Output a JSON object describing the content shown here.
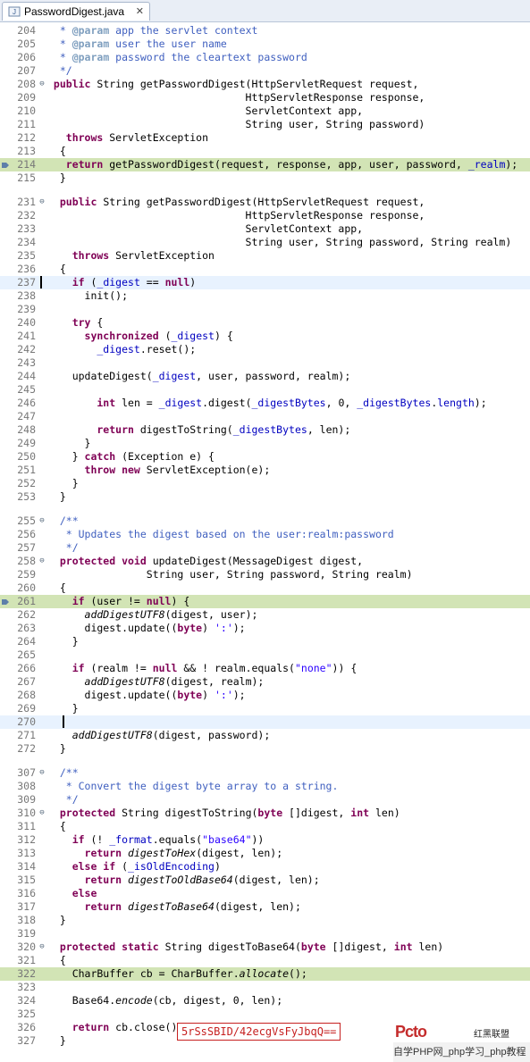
{
  "tab": {
    "label": "PasswordDigest.java",
    "close": "✕"
  },
  "code": [
    {
      "n": "204",
      "fold": "",
      "hl": "",
      "t": [
        [
          "cm",
          "  * "
        ],
        [
          "tag",
          "@param"
        ],
        [
          "cm",
          " app the servlet context"
        ]
      ]
    },
    {
      "n": "205",
      "fold": "",
      "hl": "",
      "t": [
        [
          "cm",
          "  * "
        ],
        [
          "tag",
          "@param"
        ],
        [
          "cm",
          " user the user name"
        ]
      ]
    },
    {
      "n": "206",
      "fold": "",
      "hl": "",
      "t": [
        [
          "cm",
          "  * "
        ],
        [
          "tag",
          "@param"
        ],
        [
          "cm",
          " password the cleartext password"
        ]
      ]
    },
    {
      "n": "207",
      "fold": "",
      "hl": "",
      "t": [
        [
          "cm",
          "  */"
        ]
      ]
    },
    {
      "n": "208",
      "fold": "⊖",
      "hl": "",
      "t": [
        [
          "kw",
          " public "
        ],
        [
          "",
          "String getPasswordDigest(HttpServletRequest request,"
        ]
      ]
    },
    {
      "n": "209",
      "fold": "",
      "hl": "",
      "t": [
        [
          "",
          "                                HttpServletResponse response,"
        ]
      ]
    },
    {
      "n": "210",
      "fold": "",
      "hl": "",
      "t": [
        [
          "",
          "                                ServletContext app,"
        ]
      ]
    },
    {
      "n": "211",
      "fold": "",
      "hl": "",
      "t": [
        [
          "",
          "                                String user, String password)"
        ]
      ]
    },
    {
      "n": "212",
      "fold": "",
      "hl": "",
      "t": [
        [
          "kw",
          "   throws "
        ],
        [
          "",
          "ServletException"
        ]
      ]
    },
    {
      "n": "213",
      "fold": "",
      "hl": "",
      "t": [
        [
          "",
          "  {"
        ]
      ]
    },
    {
      "n": "214",
      "fold": "",
      "hl": "green",
      "t": [
        [
          "kw",
          "   return "
        ],
        [
          "",
          "getPasswordDigest(request, response, app, user, password, "
        ],
        [
          "fld",
          "_realm"
        ],
        [
          "",
          ");"
        ]
      ]
    },
    {
      "n": "215",
      "fold": "",
      "hl": "",
      "t": [
        [
          "",
          "  }"
        ]
      ]
    },
    {
      "n": "",
      "sep": true
    },
    {
      "n": "231",
      "fold": "⊖",
      "hl": "",
      "t": [
        [
          "kw",
          "  public "
        ],
        [
          "",
          "String getPasswordDigest(HttpServletRequest request,"
        ]
      ]
    },
    {
      "n": "232",
      "fold": "",
      "hl": "",
      "t": [
        [
          "",
          "                                HttpServletResponse response,"
        ]
      ]
    },
    {
      "n": "233",
      "fold": "",
      "hl": "",
      "t": [
        [
          "",
          "                                ServletContext app,"
        ]
      ]
    },
    {
      "n": "234",
      "fold": "",
      "hl": "",
      "t": [
        [
          "",
          "                                String user, String password, String realm)"
        ]
      ]
    },
    {
      "n": "235",
      "fold": "",
      "hl": "",
      "t": [
        [
          "kw",
          "    throws "
        ],
        [
          "",
          "ServletException"
        ]
      ]
    },
    {
      "n": "236",
      "fold": "",
      "hl": "",
      "t": [
        [
          "",
          "  {"
        ]
      ]
    },
    {
      "n": "237",
      "fold": "",
      "hl": "blue",
      "t": [
        [
          "kw",
          "    if "
        ],
        [
          "",
          "("
        ],
        [
          "fld",
          "_digest"
        ],
        [
          "",
          " == "
        ],
        [
          "kw",
          "null"
        ],
        [
          "",
          ")"
        ]
      ]
    },
    {
      "n": "238",
      "fold": "",
      "hl": "",
      "t": [
        [
          "",
          "      init();"
        ]
      ]
    },
    {
      "n": "239",
      "fold": "",
      "hl": "",
      "t": [
        [
          "",
          ""
        ]
      ]
    },
    {
      "n": "240",
      "fold": "",
      "hl": "",
      "t": [
        [
          "kw",
          "    try "
        ],
        [
          "",
          "{"
        ]
      ]
    },
    {
      "n": "241",
      "fold": "",
      "hl": "",
      "t": [
        [
          "kw",
          "      synchronized "
        ],
        [
          "",
          "("
        ],
        [
          "fld",
          "_digest"
        ],
        [
          "",
          ") {"
        ]
      ]
    },
    {
      "n": "242",
      "fold": "",
      "hl": "",
      "t": [
        [
          "fld",
          "        _digest"
        ],
        [
          "",
          ".reset();"
        ]
      ]
    },
    {
      "n": "243",
      "fold": "",
      "hl": "",
      "t": [
        [
          "",
          ""
        ]
      ]
    },
    {
      "n": "244",
      "fold": "",
      "hl": "",
      "t": [
        [
          "",
          "    updateDigest("
        ],
        [
          "fld",
          "_digest"
        ],
        [
          "",
          ", user, password, realm);"
        ]
      ]
    },
    {
      "n": "245",
      "fold": "",
      "hl": "",
      "t": [
        [
          "",
          ""
        ]
      ]
    },
    {
      "n": "246",
      "fold": "",
      "hl": "",
      "t": [
        [
          "kw",
          "        int "
        ],
        [
          "",
          "len = "
        ],
        [
          "fld",
          "_digest"
        ],
        [
          "",
          ".digest("
        ],
        [
          "fld",
          "_digestBytes"
        ],
        [
          "",
          ", 0, "
        ],
        [
          "fld",
          "_digestBytes"
        ],
        [
          "",
          "."
        ],
        [
          "fld",
          "length"
        ],
        [
          "",
          ");"
        ]
      ]
    },
    {
      "n": "247",
      "fold": "",
      "hl": "",
      "t": [
        [
          "",
          ""
        ]
      ]
    },
    {
      "n": "248",
      "fold": "",
      "hl": "",
      "t": [
        [
          "kw",
          "        return "
        ],
        [
          "",
          "digestToString("
        ],
        [
          "fld",
          "_digestBytes"
        ],
        [
          "",
          ", len);"
        ]
      ]
    },
    {
      "n": "249",
      "fold": "",
      "hl": "",
      "t": [
        [
          "",
          "      }"
        ]
      ]
    },
    {
      "n": "250",
      "fold": "",
      "hl": "",
      "t": [
        [
          "",
          "    } "
        ],
        [
          "kw",
          "catch "
        ],
        [
          "",
          "(Exception e) {"
        ]
      ]
    },
    {
      "n": "251",
      "fold": "",
      "hl": "",
      "t": [
        [
          "kw",
          "      throw new "
        ],
        [
          "",
          "ServletException(e);"
        ]
      ]
    },
    {
      "n": "252",
      "fold": "",
      "hl": "",
      "t": [
        [
          "",
          "    }"
        ]
      ]
    },
    {
      "n": "253",
      "fold": "",
      "hl": "",
      "t": [
        [
          "",
          "  }"
        ]
      ]
    },
    {
      "n": "",
      "sep": true
    },
    {
      "n": "255",
      "fold": "⊖",
      "hl": "",
      "t": [
        [
          "cm",
          "  /**"
        ]
      ]
    },
    {
      "n": "256",
      "fold": "",
      "hl": "",
      "t": [
        [
          "cm",
          "   * Updates the digest based on the user:realm:password"
        ]
      ]
    },
    {
      "n": "257",
      "fold": "",
      "hl": "",
      "t": [
        [
          "cm",
          "   */"
        ]
      ]
    },
    {
      "n": "258",
      "fold": "⊖",
      "hl": "",
      "t": [
        [
          "kw",
          "  protected void "
        ],
        [
          "",
          "updateDigest(MessageDigest digest,"
        ]
      ]
    },
    {
      "n": "259",
      "fold": "",
      "hl": "",
      "t": [
        [
          "",
          "                String user, String password, String realm)"
        ]
      ]
    },
    {
      "n": "260",
      "fold": "",
      "hl": "",
      "t": [
        [
          "",
          "  {"
        ]
      ]
    },
    {
      "n": "261",
      "fold": "",
      "hl": "green",
      "t": [
        [
          "kw",
          "    if "
        ],
        [
          "",
          "(user != "
        ],
        [
          "kw",
          "null"
        ],
        [
          "",
          ") {"
        ]
      ]
    },
    {
      "n": "262",
      "fold": "",
      "hl": "",
      "t": [
        [
          "it",
          "      addDigestUTF8"
        ],
        [
          "",
          "(digest, user);"
        ]
      ]
    },
    {
      "n": "263",
      "fold": "",
      "hl": "",
      "t": [
        [
          "",
          "      digest.update(("
        ],
        [
          "kw",
          "byte"
        ],
        [
          "",
          ") "
        ],
        [
          "str",
          "':'"
        ],
        [
          "",
          ");"
        ]
      ]
    },
    {
      "n": "264",
      "fold": "",
      "hl": "",
      "t": [
        [
          "",
          "    }"
        ]
      ]
    },
    {
      "n": "265",
      "fold": "",
      "hl": "",
      "t": [
        [
          "",
          ""
        ]
      ]
    },
    {
      "n": "266",
      "fold": "",
      "hl": "",
      "t": [
        [
          "kw",
          "    if "
        ],
        [
          "",
          "(realm != "
        ],
        [
          "kw",
          "null"
        ],
        [
          "",
          " && ! realm.equals("
        ],
        [
          "str",
          "\"none\""
        ],
        [
          "",
          "))"
        ],
        [
          "",
          " {"
        ]
      ]
    },
    {
      "n": "267",
      "fold": "",
      "hl": "",
      "t": [
        [
          "it",
          "      addDigestUTF8"
        ],
        [
          "",
          "(digest, realm);"
        ]
      ]
    },
    {
      "n": "268",
      "fold": "",
      "hl": "",
      "t": [
        [
          "",
          "      digest.update(("
        ],
        [
          "kw",
          "byte"
        ],
        [
          "",
          ") "
        ],
        [
          "str",
          "':'"
        ],
        [
          "",
          ");"
        ]
      ]
    },
    {
      "n": "269",
      "fold": "",
      "hl": "",
      "t": [
        [
          "",
          "    }"
        ]
      ]
    },
    {
      "n": "270",
      "fold": "",
      "hl": "blue",
      "t": [
        [
          "",
          ""
        ]
      ]
    },
    {
      "n": "271",
      "fold": "",
      "hl": "",
      "t": [
        [
          "it",
          "    addDigestUTF8"
        ],
        [
          "",
          "(digest, password);"
        ]
      ]
    },
    {
      "n": "272",
      "fold": "",
      "hl": "",
      "t": [
        [
          "",
          "  }"
        ]
      ]
    },
    {
      "n": "",
      "sep": true
    },
    {
      "n": "307",
      "fold": "⊖",
      "hl": "",
      "t": [
        [
          "cm",
          "  /**"
        ]
      ]
    },
    {
      "n": "308",
      "fold": "",
      "hl": "",
      "t": [
        [
          "cm",
          "   * Convert the digest byte array to a string."
        ]
      ]
    },
    {
      "n": "309",
      "fold": "",
      "hl": "",
      "t": [
        [
          "cm",
          "   */"
        ]
      ]
    },
    {
      "n": "310",
      "fold": "⊖",
      "hl": "",
      "t": [
        [
          "kw",
          "  protected "
        ],
        [
          "",
          "String digestToString("
        ],
        [
          "kw",
          "byte "
        ],
        [
          "",
          "[]digest, "
        ],
        [
          "kw",
          "int "
        ],
        [
          "",
          "len)"
        ]
      ]
    },
    {
      "n": "311",
      "fold": "",
      "hl": "",
      "t": [
        [
          "",
          "  {"
        ]
      ]
    },
    {
      "n": "312",
      "fold": "",
      "hl": "",
      "t": [
        [
          "kw",
          "    if "
        ],
        [
          "",
          "(! "
        ],
        [
          "fld",
          "_format"
        ],
        [
          "",
          ".equals("
        ],
        [
          "str",
          "\"base64\""
        ],
        [
          "",
          "))"
        ]
      ]
    },
    {
      "n": "313",
      "fold": "",
      "hl": "",
      "t": [
        [
          "kw",
          "      return "
        ],
        [
          "it",
          "digestToHex"
        ],
        [
          "",
          "(digest, len);"
        ]
      ]
    },
    {
      "n": "314",
      "fold": "",
      "hl": "",
      "t": [
        [
          "kw",
          "    else if "
        ],
        [
          "",
          "("
        ],
        [
          "fld",
          "_isOldEncoding"
        ],
        [
          "",
          ")"
        ]
      ]
    },
    {
      "n": "315",
      "fold": "",
      "hl": "",
      "t": [
        [
          "kw",
          "      return "
        ],
        [
          "it",
          "digestToOldBase64"
        ],
        [
          "",
          "(digest, len);"
        ]
      ]
    },
    {
      "n": "316",
      "fold": "",
      "hl": "",
      "t": [
        [
          "kw",
          "    else"
        ]
      ]
    },
    {
      "n": "317",
      "fold": "",
      "hl": "",
      "t": [
        [
          "kw",
          "      return "
        ],
        [
          "it",
          "digestToBase64"
        ],
        [
          "",
          "(digest, len);"
        ]
      ]
    },
    {
      "n": "318",
      "fold": "",
      "hl": "",
      "t": [
        [
          "",
          "  }"
        ]
      ]
    },
    {
      "n": "319",
      "fold": "",
      "hl": "",
      "t": [
        [
          "",
          ""
        ]
      ]
    },
    {
      "n": "320",
      "fold": "⊖",
      "hl": "",
      "t": [
        [
          "kw",
          "  protected static "
        ],
        [
          "",
          "String digestToBase64("
        ],
        [
          "kw",
          "byte "
        ],
        [
          "",
          "[]digest, "
        ],
        [
          "kw",
          "int "
        ],
        [
          "",
          "len)"
        ]
      ]
    },
    {
      "n": "321",
      "fold": "",
      "hl": "",
      "t": [
        [
          "",
          "  {"
        ]
      ]
    },
    {
      "n": "322",
      "fold": "",
      "hl": "green",
      "t": [
        [
          "",
          "    CharBuffer cb = CharBuffer."
        ],
        [
          "it",
          "allocate"
        ],
        [
          "",
          "();"
        ]
      ]
    },
    {
      "n": "323",
      "fold": "",
      "hl": "",
      "t": [
        [
          "",
          ""
        ]
      ]
    },
    {
      "n": "324",
      "fold": "",
      "hl": "",
      "t": [
        [
          "",
          "    Base64."
        ],
        [
          "it",
          "encode"
        ],
        [
          "",
          "(cb, digest, 0, len);"
        ]
      ]
    },
    {
      "n": "325",
      "fold": "",
      "hl": "",
      "t": [
        [
          "",
          ""
        ]
      ]
    },
    {
      "n": "326",
      "fold": "",
      "hl": "",
      "t": [
        [
          "kw",
          "    return "
        ],
        [
          "",
          "cb.close();"
        ]
      ]
    },
    {
      "n": "327",
      "fold": "",
      "hl": "",
      "t": [
        [
          "",
          "  }"
        ]
      ]
    }
  ],
  "watermark": "5rSsSBID/42ecgVsFyJbqQ==",
  "brand": {
    "logo": "Pcto",
    "cn": "红黑联盟"
  },
  "footer": "自学PHP网_php学习_php教程"
}
